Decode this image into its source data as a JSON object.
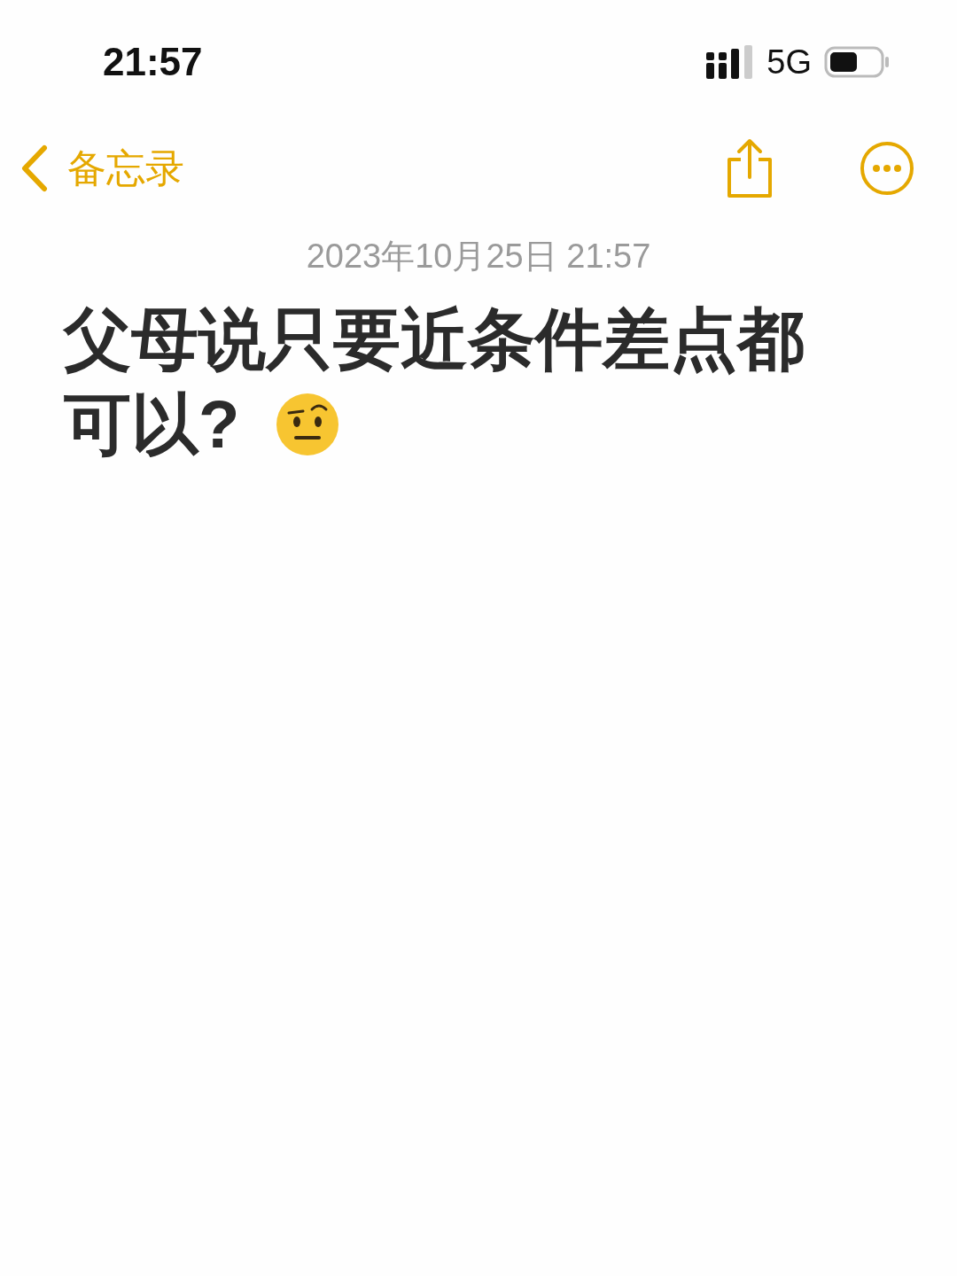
{
  "status_bar": {
    "time": "21:57",
    "network": "5G"
  },
  "nav_bar": {
    "back_label": "备忘录"
  },
  "note": {
    "date": "2023年10月25日 21:57",
    "lines": [
      "父母说只要近条件差点都",
      "可以?"
    ]
  }
}
